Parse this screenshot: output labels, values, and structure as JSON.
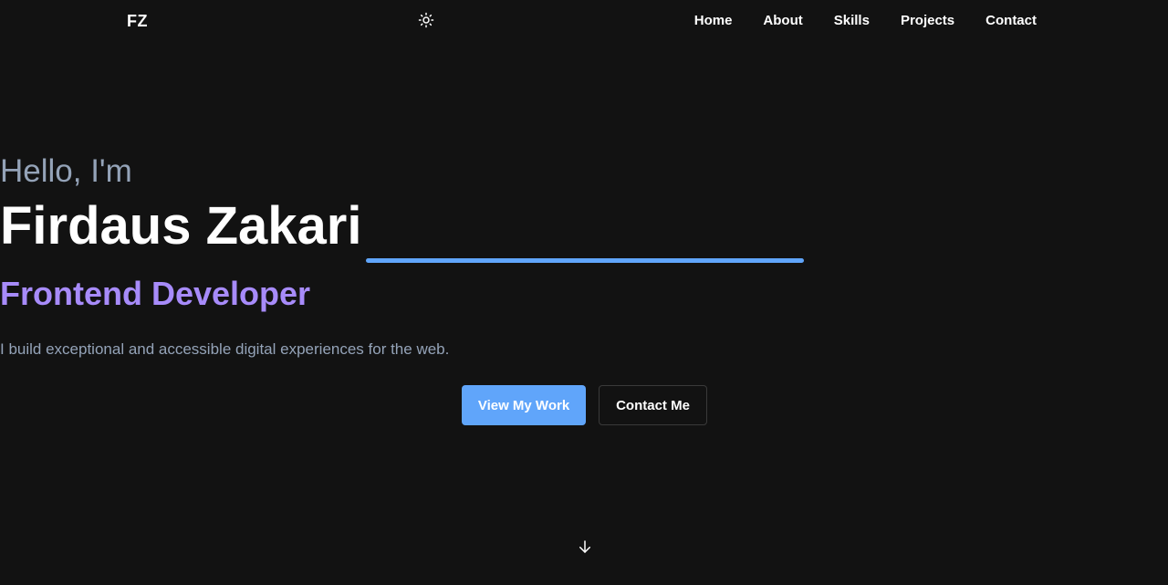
{
  "header": {
    "logo": "FZ",
    "theme_icon": "sun-icon",
    "nav": [
      {
        "label": "Home"
      },
      {
        "label": "About"
      },
      {
        "label": "Skills"
      },
      {
        "label": "Projects"
      },
      {
        "label": "Contact"
      }
    ]
  },
  "hero": {
    "greeting": "Hello, I'm",
    "name": "Firdaus Zakari",
    "role": "Frontend Developer",
    "tagline": "I build exceptional and accessible digital experiences for the web.",
    "primary_button": "View My Work",
    "secondary_button": "Contact Me",
    "scroll_icon": "arrow-down-icon"
  },
  "colors": {
    "background": "#121212",
    "accent_blue": "#60a5fa",
    "accent_purple": "#a78bfa",
    "muted_text": "#94a3b8",
    "text": "#ffffff"
  }
}
